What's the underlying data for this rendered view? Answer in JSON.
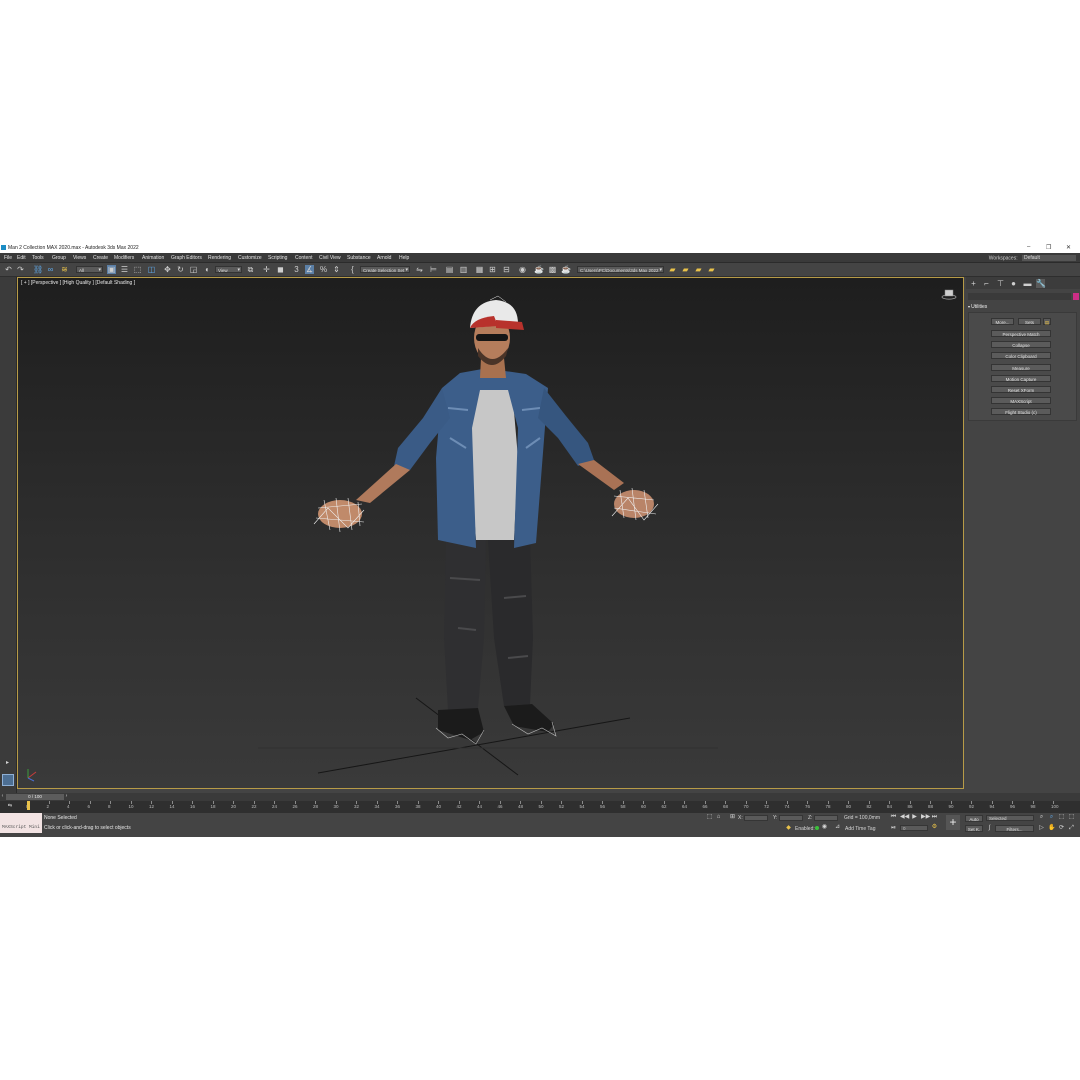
{
  "window": {
    "title": "Man 2 Collection MAX 2020.max - Autodesk 3ds Max 2022",
    "minimize": "–",
    "maximize": "❐",
    "close": "✕"
  },
  "menu": [
    "File",
    "Edit",
    "Tools",
    "Group",
    "Views",
    "Create",
    "Modifiers",
    "Animation",
    "Graph Editors",
    "Rendering",
    "Customize",
    "Scripting",
    "Content",
    "Civil View",
    "Substance",
    "Arnold",
    "Help"
  ],
  "workspace": {
    "label": "Workspaces:",
    "value": "Default"
  },
  "toolbar": {
    "selection_filter": "All",
    "reference_coord": "View",
    "named_selection": "Create Selection Set",
    "project_path": "C:\\Users\\PC\\Documents\\3ds Max 2022",
    "percent_snap": "%"
  },
  "viewport": {
    "label": "[ + ] [Perspective ] [High Quality ] [Default Shading ]"
  },
  "command_panel": {
    "rollout_title": "Utilities",
    "top_buttons": [
      "More...",
      "Sets"
    ],
    "utilities": [
      "Perspective Match",
      "Collapse",
      "Color Clipboard",
      "Measure",
      "Motion Capture",
      "Reset XForm",
      "MAXScript",
      "Flight Studio (c)"
    ]
  },
  "timeline": {
    "frame_display": "0 / 100",
    "ticks": [
      0,
      2,
      4,
      6,
      8,
      10,
      12,
      14,
      16,
      18,
      20,
      22,
      24,
      26,
      28,
      30,
      32,
      34,
      36,
      38,
      40,
      42,
      44,
      46,
      48,
      50,
      52,
      54,
      56,
      58,
      60,
      62,
      64,
      66,
      68,
      70,
      72,
      74,
      76,
      78,
      80,
      82,
      84,
      86,
      88,
      90,
      92,
      94,
      96,
      98,
      100
    ]
  },
  "status": {
    "maxscript_label": "MAXScript Mini",
    "selection": "None Selected",
    "prompt": "Click or click-and-drag to select objects",
    "x_label": "X:",
    "y_label": "Y:",
    "z_label": "Z:",
    "grid": "Grid = 100,0mm",
    "enabled_label": "Enabled:",
    "add_time_tag": "Add Time Tag",
    "auto_key": "Auto",
    "set_key": "Set K.",
    "key_filter": "Selected",
    "filters": "Filters...",
    "current_frame": "0"
  }
}
